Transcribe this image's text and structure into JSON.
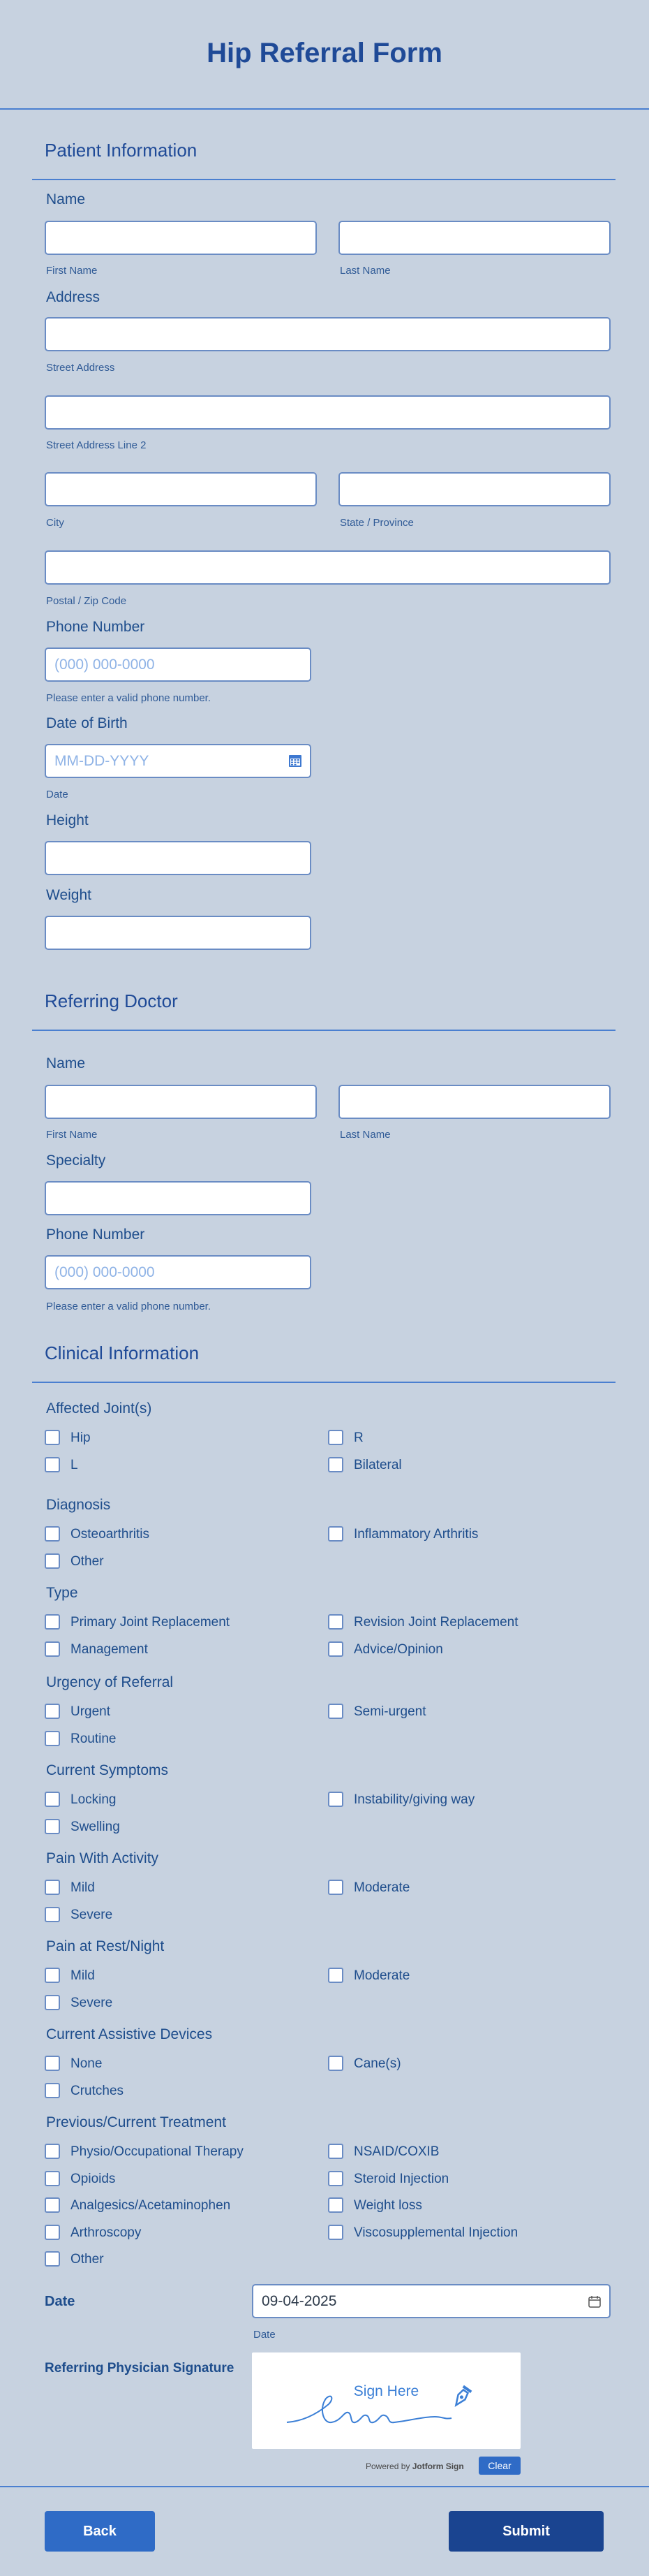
{
  "form": {
    "title": "Hip Referral Form"
  },
  "patient": {
    "section_title": "Patient Information",
    "name_label": "Name",
    "first_name_sub": "First Name",
    "last_name_sub": "Last Name",
    "address_label": "Address",
    "street_sub": "Street Address",
    "street2_sub": "Street Address Line 2",
    "city_sub": "City",
    "state_sub": "State / Province",
    "postal_sub": "Postal / Zip Code",
    "phone_label": "Phone Number",
    "phone_placeholder": "(000) 000-0000",
    "phone_hint": "Please enter a valid phone number.",
    "dob_label": "Date of Birth",
    "dob_placeholder": "MM-DD-YYYY",
    "dob_sub": "Date",
    "height_label": "Height",
    "weight_label": "Weight"
  },
  "doctor": {
    "section_title": "Referring Doctor",
    "name_label": "Name",
    "first_name_sub": "First Name",
    "last_name_sub": "Last Name",
    "specialty_label": "Specialty",
    "phone_label": "Phone Number",
    "phone_placeholder": "(000) 000-0000",
    "phone_hint": "Please enter a valid phone number."
  },
  "clinical": {
    "section_title": "Clinical Information",
    "groups": [
      {
        "label": "Affected Joint(s)",
        "options": [
          "Hip",
          "R",
          "L",
          "Bilateral"
        ]
      },
      {
        "label": "Diagnosis",
        "options": [
          "Osteoarthritis",
          "Inflammatory Arthritis",
          "Other"
        ]
      },
      {
        "label": "Type",
        "options": [
          "Primary Joint Replacement",
          "Revision Joint Replacement",
          "Management",
          "Advice/Opinion"
        ]
      },
      {
        "label": "Urgency of Referral",
        "options": [
          "Urgent",
          "Semi-urgent",
          "Routine"
        ]
      },
      {
        "label": "Current Symptoms",
        "options": [
          "Locking",
          "Instability/giving way",
          "Swelling"
        ]
      },
      {
        "label": "Pain With Activity",
        "options": [
          "Mild",
          "Moderate",
          "Severe"
        ]
      },
      {
        "label": "Pain at Rest/Night",
        "options": [
          "Mild",
          "Moderate",
          "Severe"
        ]
      },
      {
        "label": "Current Assistive Devices",
        "options": [
          "None",
          "Cane(s)",
          "Crutches"
        ]
      },
      {
        "label": "Previous/Current Treatment",
        "options": [
          "Physio/Occupational Therapy",
          "NSAID/COXIB",
          "Opioids",
          "Steroid Injection",
          "Analgesics/Acetaminophen",
          "Weight loss",
          "Arthroscopy",
          "Viscosupplemental Injection",
          "Other"
        ]
      }
    ],
    "date_label": "Date",
    "date_value": "09-04-2025",
    "date_sub": "Date",
    "signature_label": "Referring Physician Signature",
    "signature_hint": "Sign Here",
    "powered_prefix": "Powered by",
    "powered_brand": "Jotform Sign",
    "clear_label": "Clear"
  },
  "buttons": {
    "back": "Back",
    "submit": "Submit"
  },
  "colors": {
    "background": "#c7d2e0",
    "accent": "#2f6bc6",
    "submit": "#1a4490",
    "text": "#1e4d8c"
  }
}
